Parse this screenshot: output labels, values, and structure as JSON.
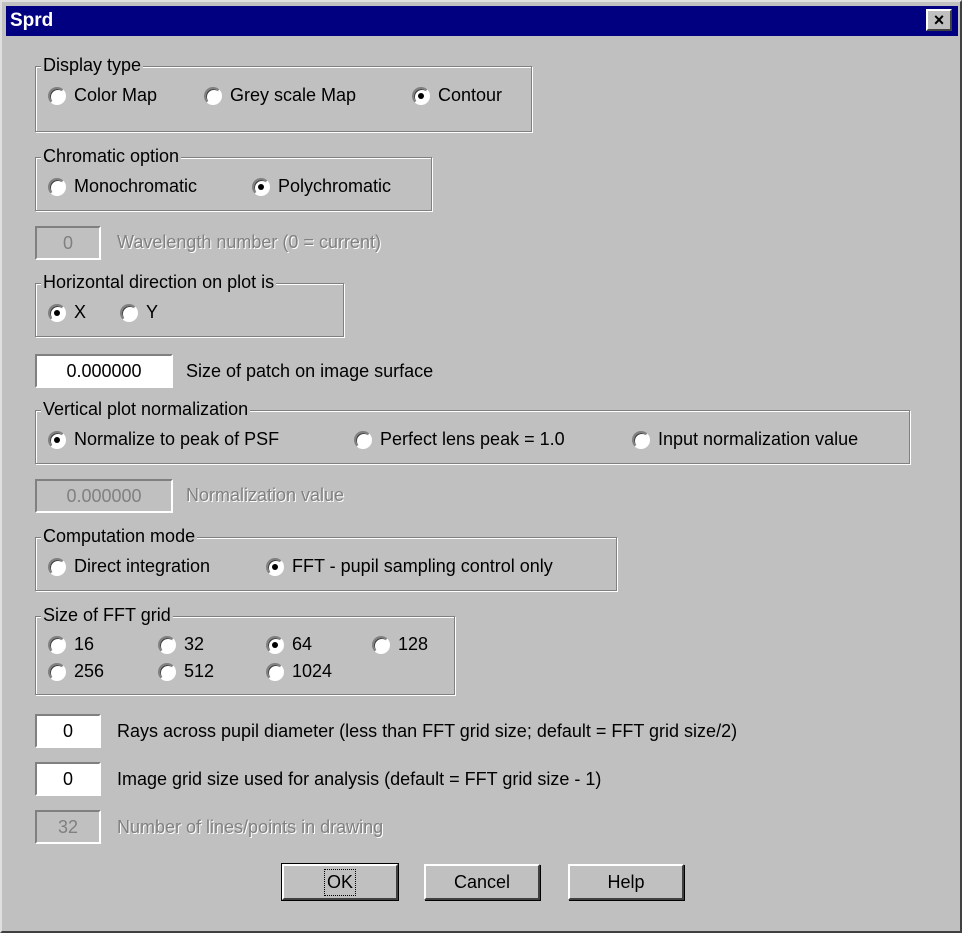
{
  "window": {
    "title": "Sprd",
    "close_label": "×"
  },
  "display_type": {
    "legend": "Display type",
    "options": [
      "Color Map",
      "Grey scale Map",
      "Contour"
    ],
    "selected": "Contour"
  },
  "chromatic": {
    "legend": "Chromatic option",
    "options": [
      "Monochromatic",
      "Polychromatic"
    ],
    "selected": "Polychromatic"
  },
  "wavelength": {
    "value": "0",
    "label": "Wavelength number (0 = current)",
    "enabled": false
  },
  "horizontal": {
    "legend": "Horizontal direction on plot is",
    "options": [
      "X",
      "Y"
    ],
    "selected": "X"
  },
  "patch": {
    "value": "0.000000",
    "label": "Size of patch on image surface"
  },
  "normalization": {
    "legend": "Vertical plot normalization",
    "options": [
      "Normalize to peak of PSF",
      "Perfect lens peak = 1.0",
      "Input normalization value"
    ],
    "selected": "Normalize to peak of PSF"
  },
  "norm_value": {
    "value": "0.000000",
    "label": "Normalization value",
    "enabled": false
  },
  "computation": {
    "legend": "Computation mode",
    "options": [
      "Direct integration",
      "FFT - pupil sampling control only"
    ],
    "selected": "FFT - pupil sampling control only"
  },
  "fft_grid": {
    "legend": "Size of FFT grid",
    "options": [
      "16",
      "32",
      "64",
      "128",
      "256",
      "512",
      "1024"
    ],
    "selected": "64"
  },
  "rays": {
    "value": "0",
    "label": "Rays across pupil diameter (less than FFT grid size; default = FFT grid size/2)"
  },
  "image_grid": {
    "value": "0",
    "label": "Image grid size used for analysis (default = FFT grid size - 1)"
  },
  "lines": {
    "value": "32",
    "label": "Number of lines/points in drawing",
    "enabled": false
  },
  "buttons": {
    "ok": "OK",
    "cancel": "Cancel",
    "help": "Help"
  }
}
